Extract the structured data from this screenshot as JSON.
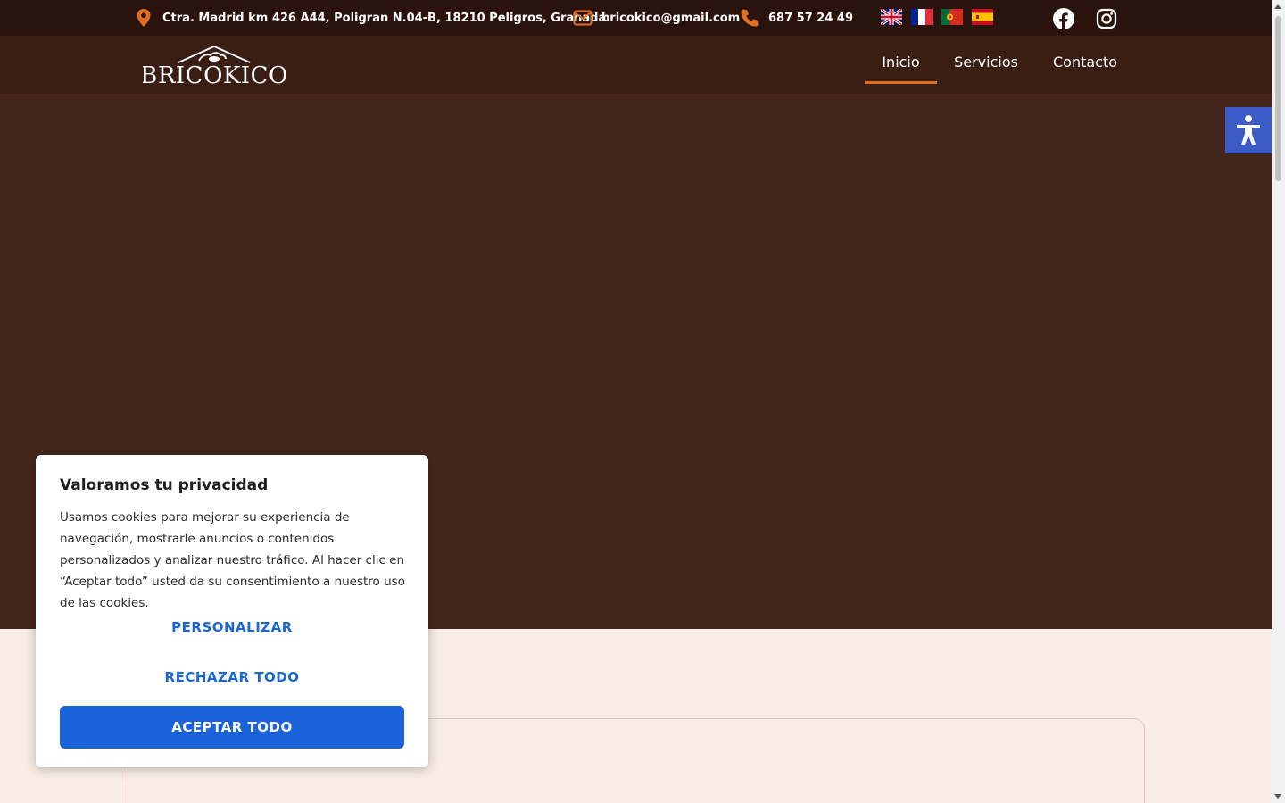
{
  "topbar": {
    "address": "Ctra. Madrid km 426 A44, Poligran N.04-B, 18210 Peligros, Granada",
    "email": "bricokico@gmail.com",
    "phone": "687 57 24 49",
    "icon_color": "#e07020",
    "icons": {
      "address": "map-pin-icon",
      "email": "envelope-icon",
      "phone": "phone-icon"
    },
    "languages": [
      "English",
      "Français",
      "Português",
      "Español"
    ],
    "socials": [
      "facebook-icon",
      "instagram-icon"
    ]
  },
  "header": {
    "logo_text": "BRICOKICO",
    "nav": [
      {
        "label": "Inicio",
        "active": true
      },
      {
        "label": "Servicios",
        "active": false
      },
      {
        "label": "Contacto",
        "active": false
      }
    ],
    "accent_color": "#e07020"
  },
  "accessibility": {
    "icon": "accessibility-icon",
    "color": "#3a5cc4"
  },
  "cookie": {
    "title": "Valoramos tu privacidad",
    "text": "Usamos cookies para mejorar su experiencia de navegación, mostrarle anuncios o contenidos personalizados y analizar nuestro tráfico. Al hacer clic en “Aceptar todo” usted da su consentimiento a nuestro uso de las cookies.",
    "customize_label": "PERSONALIZAR",
    "reject_label": "RECHAZAR TODO",
    "accept_label": "ACEPTAR TODO",
    "button_color": "#1a63d9"
  }
}
